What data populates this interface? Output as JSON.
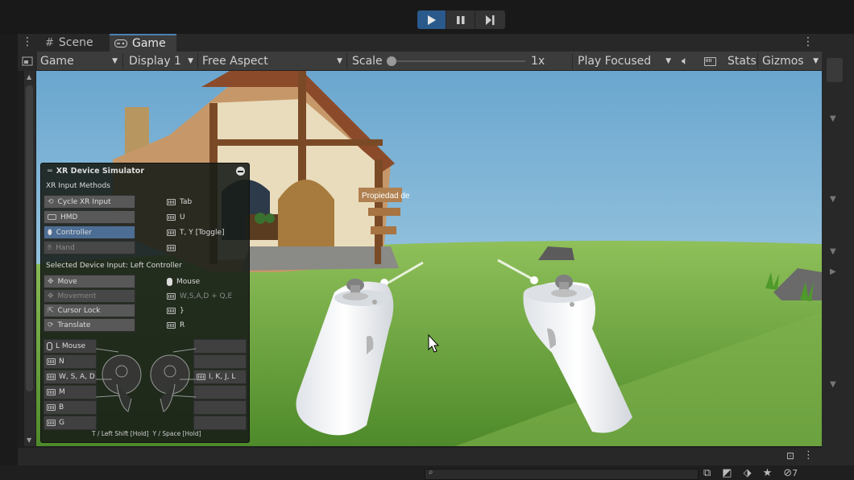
{
  "play_controls": {
    "play": "play-icon",
    "pause": "pause-icon",
    "step": "step-icon"
  },
  "tabs": [
    {
      "label": "Scene"
    },
    {
      "label": "Game"
    }
  ],
  "game_toolbar": {
    "display_mode": "Game",
    "display": "Display 1",
    "aspect": "Free Aspect",
    "scale_label": "Scale",
    "scale_value": "1x",
    "scale_level": 0.0,
    "play_mode": "Play Focused",
    "stats": "Stats",
    "gizmos": "Gizmos"
  },
  "scene": {
    "sign_text": "Propiedad de"
  },
  "xr_simulator": {
    "title": "XR Device Simulator",
    "section1": "XR Input Methods",
    "methods": [
      {
        "label": "Cycle XR Input",
        "key": "Tab",
        "state": "normal"
      },
      {
        "label": "HMD",
        "key": "U",
        "state": "normal"
      },
      {
        "label": "Controller",
        "key": "T, Y [Toggle]",
        "state": "selected"
      },
      {
        "label": "Hand",
        "key": "",
        "state": "disabled"
      }
    ],
    "section2": "Selected Device Input: Left Controller",
    "device_inputs": [
      {
        "label": "Move",
        "key": "Mouse",
        "state": "normal"
      },
      {
        "label": "Movement",
        "key": "W,S,A,D + Q,E",
        "state": "disabled"
      },
      {
        "label": "Cursor Lock",
        "key": "}",
        "state": "normal"
      },
      {
        "label": "Translate",
        "key": "R",
        "state": "normal"
      }
    ],
    "left_bindings": [
      "L Mouse",
      "N",
      "W, S, A, D",
      "M",
      "B",
      "G"
    ],
    "right_bindings": [
      "",
      "",
      "I, K, J, L",
      "",
      "",
      ""
    ],
    "footer": "T / Left Shift [Hold]  Y / Space [Hold]"
  },
  "status": {
    "hidden_count": "7"
  },
  "colors": {
    "accent": "#4d80b4",
    "play_active": "#2a5a8c",
    "selected": "#4d6e94"
  }
}
